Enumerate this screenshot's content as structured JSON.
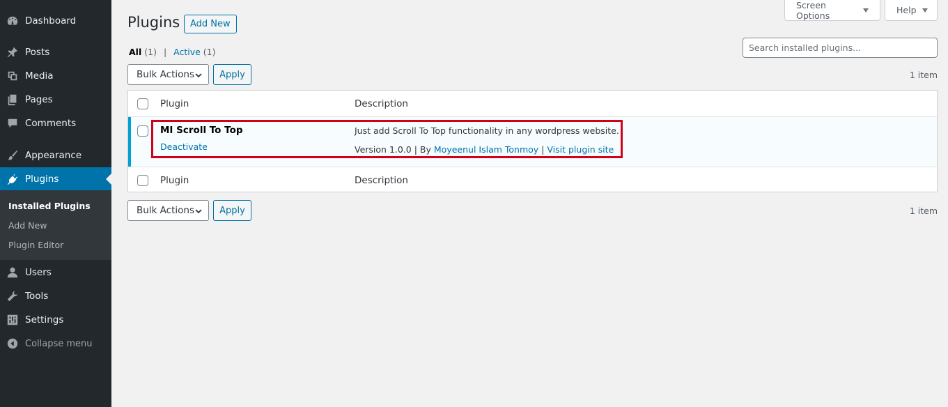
{
  "sidebar": {
    "items": [
      {
        "label": "Dashboard",
        "icon": "dashboard-icon"
      },
      {
        "label": "Posts",
        "icon": "pin-icon"
      },
      {
        "label": "Media",
        "icon": "media-icon"
      },
      {
        "label": "Pages",
        "icon": "pages-icon"
      },
      {
        "label": "Comments",
        "icon": "comment-icon"
      },
      {
        "label": "Appearance",
        "icon": "brush-icon"
      },
      {
        "label": "Plugins",
        "icon": "plugin-icon"
      },
      {
        "label": "Users",
        "icon": "users-icon"
      },
      {
        "label": "Tools",
        "icon": "wrench-icon"
      },
      {
        "label": "Settings",
        "icon": "settings-icon"
      }
    ],
    "submenu": [
      "Installed Plugins",
      "Add New",
      "Plugin Editor"
    ],
    "collapse_label": "Collapse menu"
  },
  "top_tabs": {
    "screen_options": "Screen Options",
    "help": "Help"
  },
  "header": {
    "title": "Plugins",
    "add_new": "Add New"
  },
  "filters": {
    "all_label": "All",
    "all_count": "(1)",
    "separator": "|",
    "active_label": "Active",
    "active_count": "(1)"
  },
  "search": {
    "placeholder": "Search installed plugins..."
  },
  "bulk": {
    "label": "Bulk Actions",
    "apply": "Apply",
    "count": "1 item"
  },
  "table": {
    "col_plugin": "Plugin",
    "col_description": "Description",
    "row": {
      "name": "MI Scroll To Top",
      "action": "Deactivate",
      "description": "Just add Scroll To Top functionality in any wordpress website.",
      "version": "Version 1.0.0",
      "by": "By",
      "author": "Moyeenul Islam Tonmoy",
      "sep": "|",
      "visit": "Visit plugin site"
    }
  },
  "colors": {
    "sidebar_bg": "#23282d",
    "accent": "#0073aa",
    "highlight": "#d0021b"
  }
}
